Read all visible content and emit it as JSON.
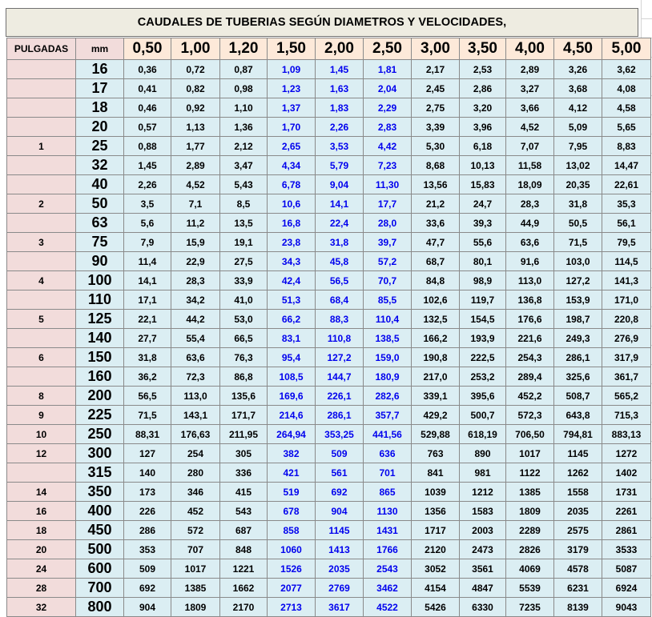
{
  "title": "CAUDALES DE TUBERIAS SEGÚN  DIAMETROS Y VELOCIDADES,",
  "headers": {
    "inches": "PULGADAS",
    "mm": "mm",
    "velocities": [
      "0,50",
      "1,00",
      "1,20",
      "1,50",
      "2,00",
      "2,50",
      "3,00",
      "3,50",
      "4,00",
      "4,50",
      "5,00"
    ]
  },
  "colors": {
    "title_bg": "#eeece1",
    "header_bg": "#fde9d9",
    "inch_bg": "#f2dcdb",
    "cell_bg": "#dbeef3",
    "blue_text": "#0000ee"
  },
  "rows": [
    {
      "inch": "",
      "mm": "16",
      "values": [
        "0,36",
        "0,72",
        "0,87",
        "1,09",
        "1,45",
        "1,81",
        "2,17",
        "2,53",
        "2,89",
        "3,26",
        "3,62"
      ]
    },
    {
      "inch": "",
      "mm": "17",
      "values": [
        "0,41",
        "0,82",
        "0,98",
        "1,23",
        "1,63",
        "2,04",
        "2,45",
        "2,86",
        "3,27",
        "3,68",
        "4,08"
      ]
    },
    {
      "inch": "",
      "mm": "18",
      "values": [
        "0,46",
        "0,92",
        "1,10",
        "1,37",
        "1,83",
        "2,29",
        "2,75",
        "3,20",
        "3,66",
        "4,12",
        "4,58"
      ]
    },
    {
      "inch": "",
      "mm": "20",
      "values": [
        "0,57",
        "1,13",
        "1,36",
        "1,70",
        "2,26",
        "2,83",
        "3,39",
        "3,96",
        "4,52",
        "5,09",
        "5,65"
      ]
    },
    {
      "inch": "1",
      "mm": "25",
      "values": [
        "0,88",
        "1,77",
        "2,12",
        "2,65",
        "3,53",
        "4,42",
        "5,30",
        "6,18",
        "7,07",
        "7,95",
        "8,83"
      ]
    },
    {
      "inch": "",
      "mm": "32",
      "values": [
        "1,45",
        "2,89",
        "3,47",
        "4,34",
        "5,79",
        "7,23",
        "8,68",
        "10,13",
        "11,58",
        "13,02",
        "14,47"
      ]
    },
    {
      "inch": "",
      "mm": "40",
      "values": [
        "2,26",
        "4,52",
        "5,43",
        "6,78",
        "9,04",
        "11,30",
        "13,56",
        "15,83",
        "18,09",
        "20,35",
        "22,61"
      ]
    },
    {
      "inch": "2",
      "mm": "50",
      "values": [
        "3,5",
        "7,1",
        "8,5",
        "10,6",
        "14,1",
        "17,7",
        "21,2",
        "24,7",
        "28,3",
        "31,8",
        "35,3"
      ]
    },
    {
      "inch": "",
      "mm": "63",
      "values": [
        "5,6",
        "11,2",
        "13,5",
        "16,8",
        "22,4",
        "28,0",
        "33,6",
        "39,3",
        "44,9",
        "50,5",
        "56,1"
      ]
    },
    {
      "inch": "3",
      "mm": "75",
      "values": [
        "7,9",
        "15,9",
        "19,1",
        "23,8",
        "31,8",
        "39,7",
        "47,7",
        "55,6",
        "63,6",
        "71,5",
        "79,5"
      ]
    },
    {
      "inch": "",
      "mm": "90",
      "values": [
        "11,4",
        "22,9",
        "27,5",
        "34,3",
        "45,8",
        "57,2",
        "68,7",
        "80,1",
        "91,6",
        "103,0",
        "114,5"
      ]
    },
    {
      "inch": "4",
      "mm": "100",
      "values": [
        "14,1",
        "28,3",
        "33,9",
        "42,4",
        "56,5",
        "70,7",
        "84,8",
        "98,9",
        "113,0",
        "127,2",
        "141,3"
      ]
    },
    {
      "inch": "",
      "mm": "110",
      "values": [
        "17,1",
        "34,2",
        "41,0",
        "51,3",
        "68,4",
        "85,5",
        "102,6",
        "119,7",
        "136,8",
        "153,9",
        "171,0"
      ]
    },
    {
      "inch": "5",
      "mm": "125",
      "values": [
        "22,1",
        "44,2",
        "53,0",
        "66,2",
        "88,3",
        "110,4",
        "132,5",
        "154,5",
        "176,6",
        "198,7",
        "220,8"
      ]
    },
    {
      "inch": "",
      "mm": "140",
      "values": [
        "27,7",
        "55,4",
        "66,5",
        "83,1",
        "110,8",
        "138,5",
        "166,2",
        "193,9",
        "221,6",
        "249,3",
        "276,9"
      ]
    },
    {
      "inch": "6",
      "mm": "150",
      "values": [
        "31,8",
        "63,6",
        "76,3",
        "95,4",
        "127,2",
        "159,0",
        "190,8",
        "222,5",
        "254,3",
        "286,1",
        "317,9"
      ]
    },
    {
      "inch": "",
      "mm": "160",
      "values": [
        "36,2",
        "72,3",
        "86,8",
        "108,5",
        "144,7",
        "180,9",
        "217,0",
        "253,2",
        "289,4",
        "325,6",
        "361,7"
      ]
    },
    {
      "inch": "8",
      "mm": "200",
      "values": [
        "56,5",
        "113,0",
        "135,6",
        "169,6",
        "226,1",
        "282,6",
        "339,1",
        "395,6",
        "452,2",
        "508,7",
        "565,2"
      ]
    },
    {
      "inch": "9",
      "mm": "225",
      "values": [
        "71,5",
        "143,1",
        "171,7",
        "214,6",
        "286,1",
        "357,7",
        "429,2",
        "500,7",
        "572,3",
        "643,8",
        "715,3"
      ]
    },
    {
      "inch": "10",
      "mm": "250",
      "values": [
        "88,31",
        "176,63",
        "211,95",
        "264,94",
        "353,25",
        "441,56",
        "529,88",
        "618,19",
        "706,50",
        "794,81",
        "883,13"
      ]
    },
    {
      "inch": "12",
      "mm": "300",
      "values": [
        "127",
        "254",
        "305",
        "382",
        "509",
        "636",
        "763",
        "890",
        "1017",
        "1145",
        "1272"
      ]
    },
    {
      "inch": "",
      "mm": "315",
      "values": [
        "140",
        "280",
        "336",
        "421",
        "561",
        "701",
        "841",
        "981",
        "1122",
        "1262",
        "1402"
      ]
    },
    {
      "inch": "14",
      "mm": "350",
      "values": [
        "173",
        "346",
        "415",
        "519",
        "692",
        "865",
        "1039",
        "1212",
        "1385",
        "1558",
        "1731"
      ]
    },
    {
      "inch": "16",
      "mm": "400",
      "values": [
        "226",
        "452",
        "543",
        "678",
        "904",
        "1130",
        "1356",
        "1583",
        "1809",
        "2035",
        "2261"
      ]
    },
    {
      "inch": "18",
      "mm": "450",
      "values": [
        "286",
        "572",
        "687",
        "858",
        "1145",
        "1431",
        "1717",
        "2003",
        "2289",
        "2575",
        "2861"
      ]
    },
    {
      "inch": "20",
      "mm": "500",
      "values": [
        "353",
        "707",
        "848",
        "1060",
        "1413",
        "1766",
        "2120",
        "2473",
        "2826",
        "3179",
        "3533"
      ]
    },
    {
      "inch": "24",
      "mm": "600",
      "values": [
        "509",
        "1017",
        "1221",
        "1526",
        "2035",
        "2543",
        "3052",
        "3561",
        "4069",
        "4578",
        "5087"
      ]
    },
    {
      "inch": "28",
      "mm": "700",
      "values": [
        "692",
        "1385",
        "1662",
        "2077",
        "2769",
        "3462",
        "4154",
        "4847",
        "5539",
        "6231",
        "6924"
      ]
    },
    {
      "inch": "32",
      "mm": "800",
      "values": [
        "904",
        "1809",
        "2170",
        "2713",
        "3617",
        "4522",
        "5426",
        "6330",
        "7235",
        "8139",
        "9043"
      ]
    }
  ]
}
